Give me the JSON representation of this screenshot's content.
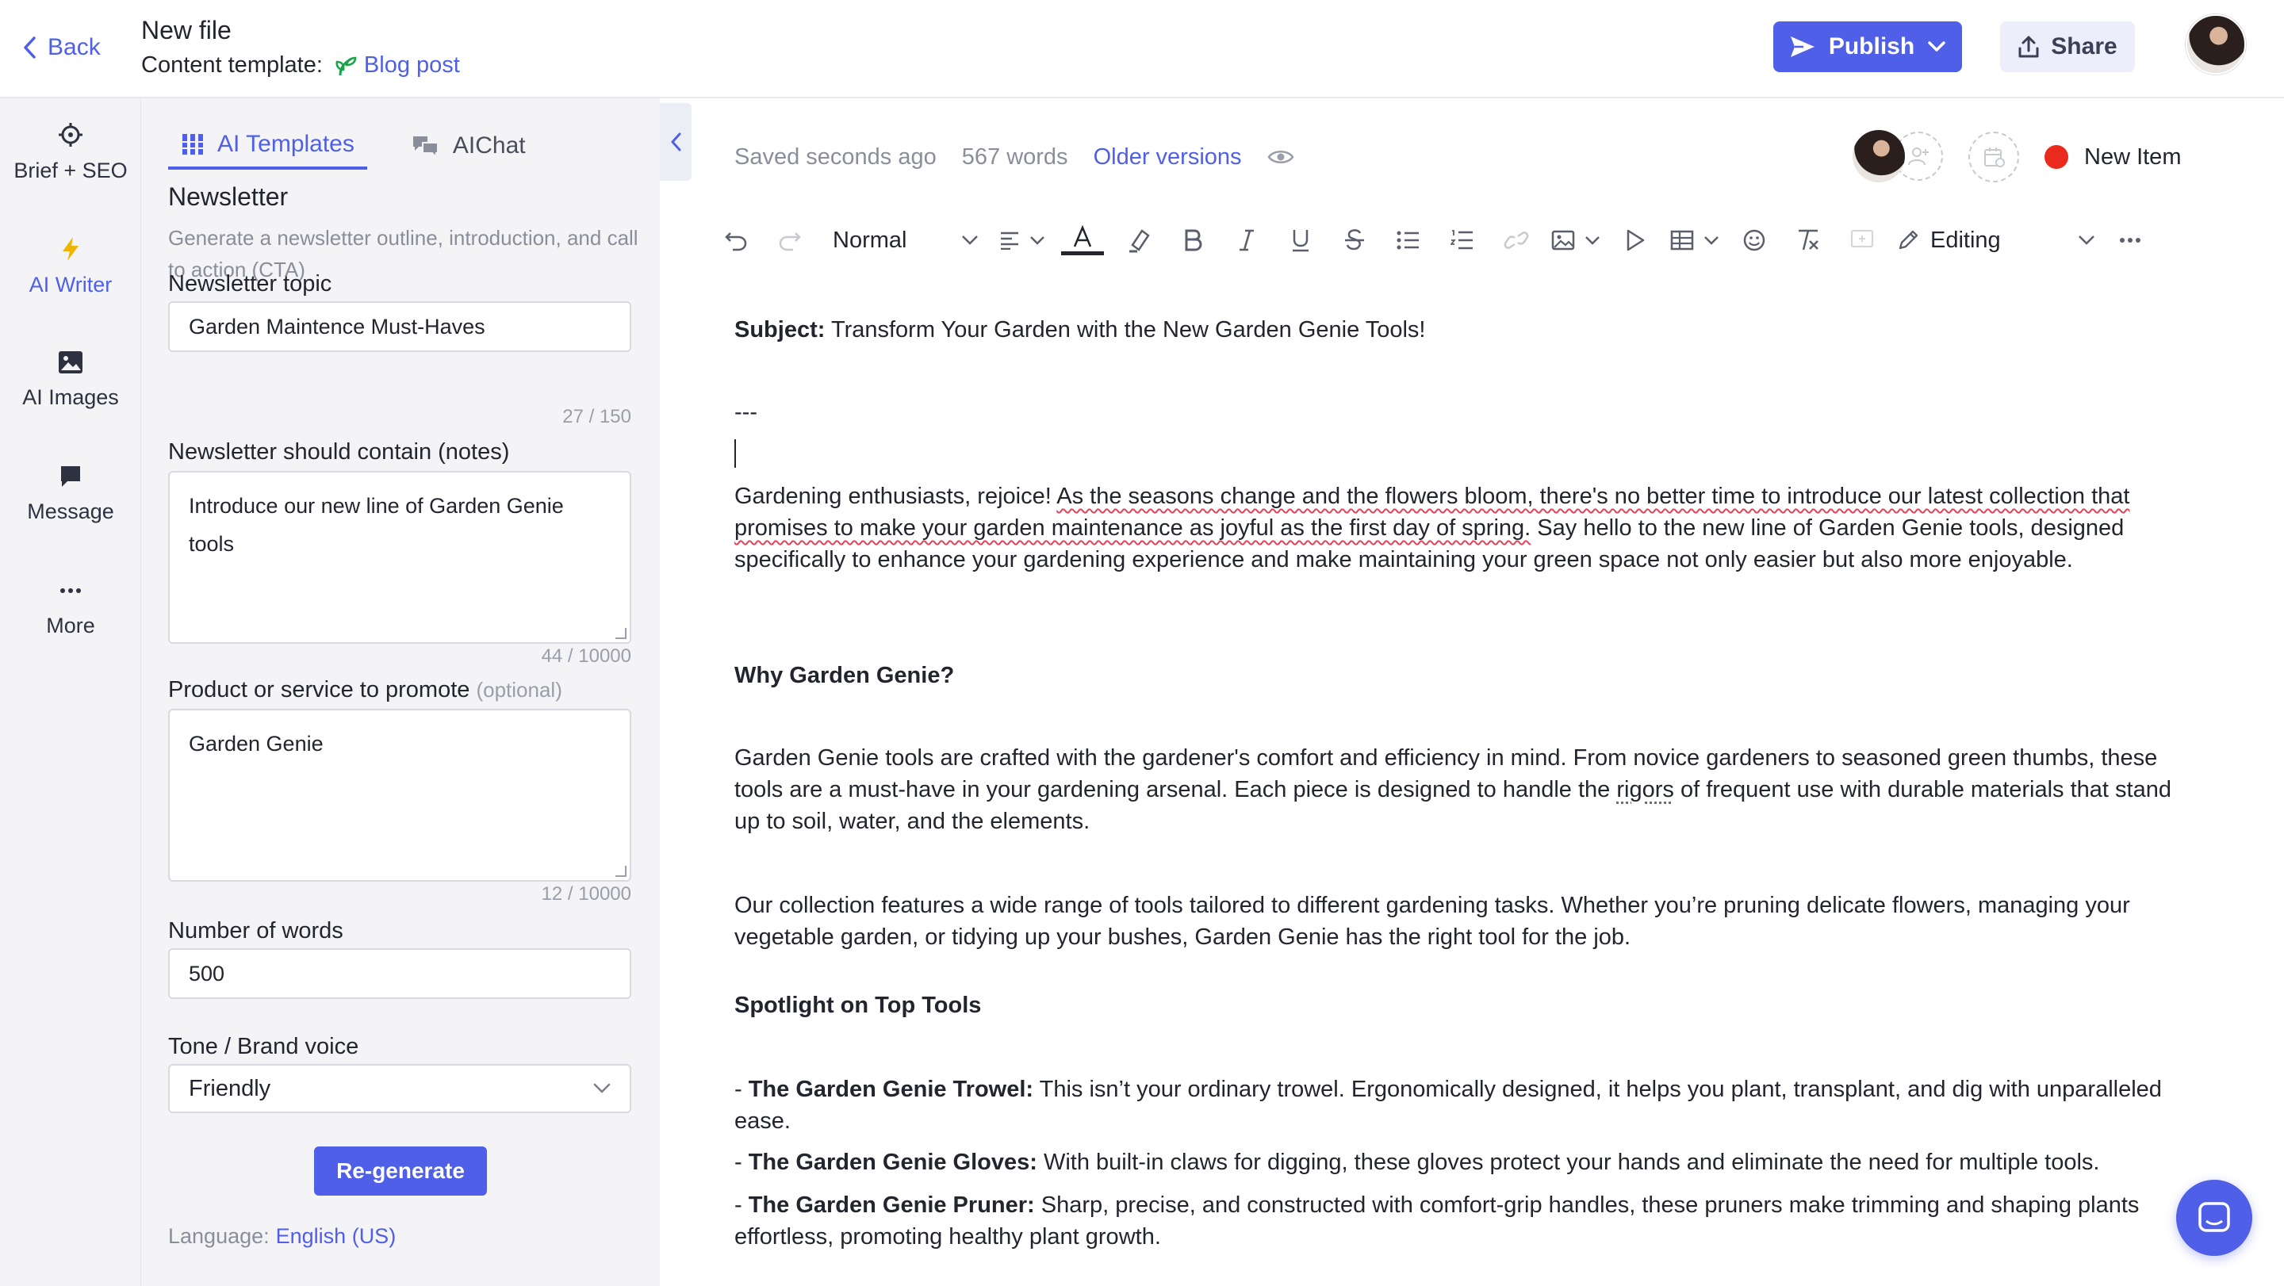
{
  "header": {
    "back_label": "Back",
    "file_title": "New file",
    "template_prefix": "Content template:",
    "template_name": "Blog post",
    "publish_label": "Publish",
    "share_label": "Share"
  },
  "rail": {
    "items": [
      {
        "label": "Brief + SEO",
        "icon": "crosshair-icon"
      },
      {
        "label": "AI Writer",
        "icon": "lightning-icon",
        "active": true
      },
      {
        "label": "AI Images",
        "icon": "image-icon"
      },
      {
        "label": "Message",
        "icon": "chat-bubble-icon"
      },
      {
        "label": "More",
        "icon": "more-dots-icon"
      }
    ]
  },
  "panel": {
    "tabs": [
      {
        "label": "AI Templates",
        "active": true
      },
      {
        "label": "AIChat",
        "active": false
      }
    ],
    "heading": "Newsletter",
    "description": "Generate a newsletter outline, introduction, and call to action (CTA)",
    "topic": {
      "label": "Newsletter topic",
      "value": "Garden Maintence Must-Haves",
      "counter": "27 / 150"
    },
    "notes": {
      "label": "Newsletter should contain (notes)",
      "value": "Introduce our new line of Garden Genie tools",
      "counter": "44 / 10000"
    },
    "product": {
      "label": "Product or service to promote",
      "optional": "(optional)",
      "value": "Garden Genie",
      "counter": "12 / 10000"
    },
    "words": {
      "label": "Number of words",
      "value": "500"
    },
    "tone": {
      "label": "Tone / Brand voice",
      "value": "Friendly"
    },
    "regenerate_label": "Re-generate",
    "language_prefix": "Language:",
    "language_value": "English (US)"
  },
  "editor": {
    "saved_status": "Saved seconds ago",
    "word_count": "567 words",
    "older_versions": "Older versions",
    "new_item_label": "New Item",
    "toolbar": {
      "style_value": "Normal",
      "editing_value": "Editing"
    },
    "content": {
      "subject_label": "Subject:",
      "subject_text": " Transform Your Garden with the New Garden Genie Tools!",
      "separator": "---",
      "intro_start": "Gardening enthusiasts, rejoice! ",
      "intro_flagged": "As the seasons change and the flowers bloom, there's no better time to introduce our latest collection that promises to make your garden maintenance as joyful as the first day of spring.",
      "intro_end": " Say hello to the new line of Garden Genie tools, designed specifically to enhance your gardening experience and make maintaining your green space not only easier but also more enjoyable.",
      "why_heading": "Why Garden Genie?",
      "why_text_a": "Garden Genie tools are crafted with the gardener's comfort and efficiency in mind. From novice gardeners to seasoned green thumbs, these tools are a must-have in your gardening arsenal. Each piece is designed to handle the ",
      "why_text_flag": "rigors",
      "why_text_b": " of frequent use with durable materials that stand up to soil, water, and the elements.",
      "collection_text": "Our collection features a wide range of tools tailored to different gardening tasks. Whether you’re pruning delicate flowers, managing your vegetable garden, or tidying up your bushes, Garden Genie has the right tool for the job.",
      "spotlight_heading": "Spotlight on Top Tools",
      "tools": [
        {
          "prefix": "- ",
          "name": "The Garden Genie Trowel:",
          "text": " This isn’t your ordinary trowel. Ergonomically designed, it helps you plant, transplant, and dig with unparalleled ease."
        },
        {
          "prefix": "- ",
          "name": "The Garden Genie Gloves:",
          "text": " With built-in claws for digging, these gloves protect your hands and eliminate the need for multiple tools."
        },
        {
          "prefix": "- ",
          "name": "The Garden Genie Pruner:",
          "text": " Sharp, precise, and constructed with comfort-grip handles, these pruners make trimming and shaping plants effortless, promoting healthy plant growth."
        }
      ]
    }
  },
  "colors": {
    "accent": "#4f5fe8",
    "status_dot": "#ea2a1d",
    "template_icon": "#1aa34a"
  }
}
